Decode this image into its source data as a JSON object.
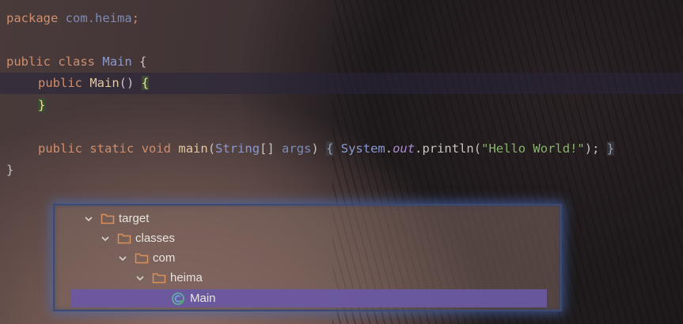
{
  "code": {
    "line1": {
      "kw": "package",
      "pkg": "com.heima",
      "semi": ";"
    },
    "line3": {
      "kw1": "public",
      "kw2": "class",
      "cls": "Main",
      "brace": "{"
    },
    "line4": {
      "kw": "public",
      "fn": "Main",
      "parens": "()",
      "brace": "{"
    },
    "line5": {
      "brace": "}"
    },
    "line7": {
      "kw1": "public",
      "kw2": "static",
      "kw3": "void",
      "fn": "main",
      "p1": "(",
      "type": "String",
      "arr": "[]",
      "arg": "args",
      "p2": ")",
      "brace1": "{",
      "sys": "System",
      "dot1": ".",
      "out": "out",
      "dot2": ".",
      "call": "println",
      "p3": "(",
      "str": "\"Hello World!\"",
      "p4": ");",
      "brace2": "}"
    },
    "line8": {
      "brace": "}"
    }
  },
  "project_tree": {
    "items": [
      {
        "label": "target",
        "type": "folder"
      },
      {
        "label": "classes",
        "type": "folder"
      },
      {
        "label": "com",
        "type": "folder"
      },
      {
        "label": "heima",
        "type": "folder"
      },
      {
        "label": "Main",
        "type": "class",
        "selected": true
      }
    ]
  },
  "colors": {
    "keyword": "#cf8e6d",
    "package": "#7e8bb5",
    "string": "#88b56a",
    "selection": "#6a58a3",
    "panel_border_glow": "#466ebe"
  }
}
